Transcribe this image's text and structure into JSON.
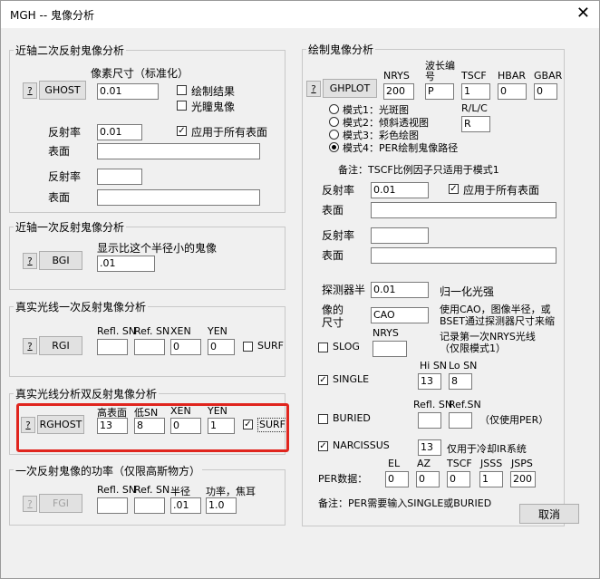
{
  "window": {
    "title": "MGH -- 鬼像分析",
    "close_glyph": "✕"
  },
  "ghost": {
    "group_title": "近轴二次反射鬼像分析",
    "q": "?",
    "button": "GHOST",
    "pixel_label": "像素尺寸（标准化）",
    "pixel_value": "0.01",
    "plot_result": "绘制结果",
    "pupil_ghost": "光瞳鬼像",
    "refl_label1": "反射率",
    "refl_value1": "0.01",
    "apply_all": "应用于所有表面",
    "surface_label1": "表面",
    "refl_label2": "反射率",
    "surface_label2": "表面"
  },
  "bgi": {
    "group_title": "近轴一次反射鬼像分析",
    "q": "?",
    "button": "BGI",
    "desc": "显示比这个半径小的鬼像",
    "value": ".01"
  },
  "rgi": {
    "group_title": "真实光线一次反射鬼像分析",
    "q": "?",
    "button": "RGI",
    "h_refl_sn1": "Refl. SN",
    "h_refl_sn2": "Ref. SN",
    "h_xen": "XEN",
    "h_yen": "YEN",
    "xen": "0",
    "yen": "0",
    "surf": "SURF"
  },
  "rghost": {
    "group_title": "真实光线分析双反射鬼像分析",
    "q": "?",
    "button": "RGHOST",
    "h_hi": "高表面",
    "h_lo": "低SN",
    "h_xen": "XEN",
    "h_yen": "YEN",
    "hi": "13",
    "lo": "8",
    "xen": "0",
    "yen": "1",
    "surf": "SURF"
  },
  "fgi": {
    "group_title": "一次反射鬼像的功率（仅限高斯物方）",
    "q": "?",
    "button": "FGI",
    "h_refl_sn1": "Refl. SN",
    "h_refl_sn2": "Ref. SN",
    "h_radius": "半径",
    "h_power": "功率，焦耳",
    "radius": ".01",
    "power": "1.0"
  },
  "ghplot": {
    "group_title": "绘制鬼像分析",
    "q": "?",
    "button": "GHPLOT",
    "h_nrys": "NRYS",
    "h_wave": "波长编号",
    "h_tscf": "TSCF",
    "h_hbar": "HBAR",
    "h_gbar": "GBAR",
    "nrys": "200",
    "wave": "P",
    "tscf": "1",
    "hbar": "0",
    "gbar": "0",
    "h_rlc": "R/L/C",
    "rlc": "R",
    "mode1": "模式1：光斑图",
    "mode2": "模式2：倾斜透视图",
    "mode3": "模式3：彩色绘图",
    "mode4": "模式4：PER绘制鬼像路径",
    "note_tscf": "备注：TSCF比例因子只适用于模式1",
    "refl_label1": "反射率",
    "refl_value1": "0.01",
    "apply_all": "应用于所有表面",
    "surface_label1": "表面",
    "refl_label2": "反射率",
    "surface_label2": "表面",
    "detector_label": "探测器半",
    "detector_value": "0.01",
    "normalized": "归一化光强",
    "image_size_label": "像的尺寸",
    "image_size_value": "CAO",
    "image_size_desc": "使用CAO，图像半径，或BSET通过探测器尺寸来缩放",
    "slog": "SLOG",
    "slog_nrys": "NRYS",
    "slog_desc": "记录第一次NRYS光线（仅限模式1）",
    "single": "SINGLE",
    "hi_sn": "Hi SN",
    "lo_sn": "Lo SN",
    "single_hi": "13",
    "single_lo": "8",
    "buried": "BURIED",
    "refl_sn": "Refl. SN",
    "ref_sn": "Ref.SN",
    "per_only": "（仅使用PER）",
    "narcissus": "NARCISSUS",
    "narc_value": "13",
    "narc_desc": "仅用于冷却IR系统",
    "per_label": "PER数据：",
    "h_el": "EL",
    "h_az": "AZ",
    "h_tscf2": "TSCF",
    "h_jsss": "JSSS",
    "h_jsps": "JSPS",
    "el": "0",
    "az": "0",
    "tscf2": "0",
    "jsss": "1",
    "jsps": "200",
    "note_per": "备注：PER需要输入SINGLE或BURIED",
    "cancel": "取消"
  }
}
